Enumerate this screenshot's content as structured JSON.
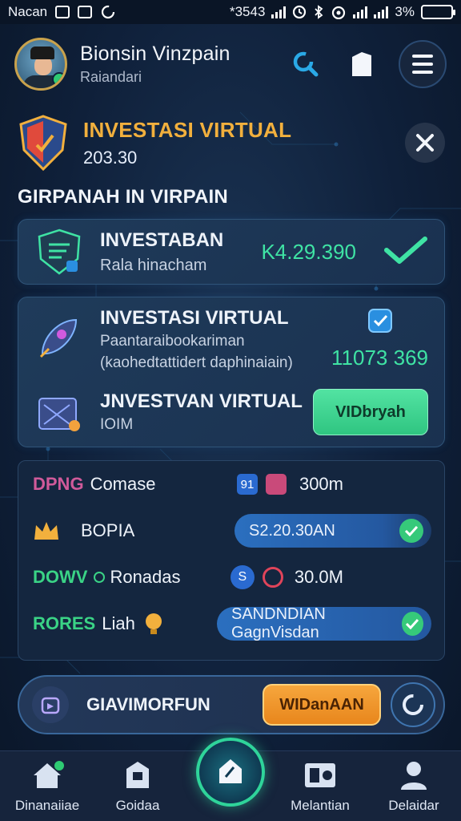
{
  "status_bar": {
    "carrier": "Nacan",
    "center": "*3543",
    "battery": "3%"
  },
  "header": {
    "user_name": "Bionsin Vinzpain",
    "user_sub": "Raiandari"
  },
  "virtual": {
    "title": "INVESTASI VIRTUAL",
    "value": "203.30"
  },
  "section": {
    "title": "GIRPANAH IN VIRPAIN"
  },
  "card1": {
    "title": "INVESTABAN",
    "subtitle": "Rala hinacham",
    "amount": "K4.29.390"
  },
  "card2": {
    "title": "INVESTASI VIRTUAL",
    "subtitle_line1": "Paantaraibookariman",
    "subtitle_line2": "(kaohedtattidert daphinaiain)",
    "amount": "11073 369",
    "row2_title": "JNVESTVAN VIRTUAL",
    "row2_sub": "IOIM",
    "button": "VIDbryah"
  },
  "list": [
    {
      "tag": "DPNG",
      "tag_color": "#d05a9a",
      "name": "Comase",
      "value": "300m"
    },
    {
      "tag": "",
      "tag_color": "#f2b03d",
      "name": "BOPIA",
      "pill": "S2.20.30AN"
    },
    {
      "tag": "DOWV",
      "tag_color": "#3ad386",
      "name": "Ronadas",
      "value": "30.0M"
    },
    {
      "tag": "RORES",
      "tag_color": "#3ad386",
      "name": "Liah",
      "pill": "SANDNDIAN GagnVisdan"
    }
  ],
  "action": {
    "label": "GIAVIMORFUN",
    "button": "WIDanAAN"
  },
  "nav": [
    {
      "label": "Dinanaiiae",
      "icon": "home-icon"
    },
    {
      "label": "Goidaa",
      "icon": "building-icon"
    },
    {
      "label": "Melantian",
      "icon": "film-icon"
    },
    {
      "label": "Delaidar",
      "icon": "profile-icon"
    }
  ],
  "colors": {
    "accent_green": "#3fe3a4",
    "accent_orange": "#f2b03d",
    "background": "#0e1c33"
  }
}
